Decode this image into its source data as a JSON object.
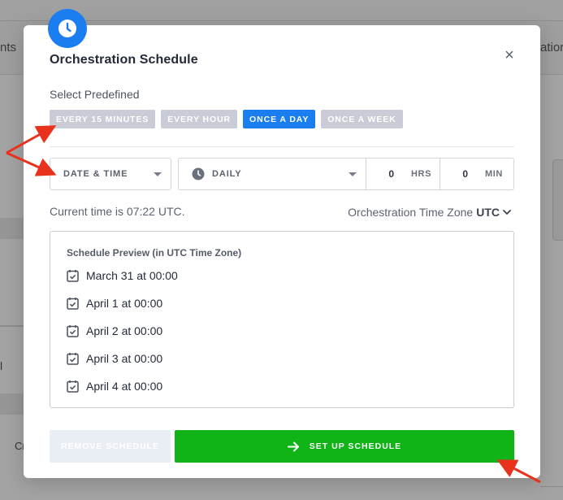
{
  "background": {
    "tab_left_fragment": "nts",
    "tab_right_fragment": "ation",
    "row_fragment_a": "l",
    "row_fragment_b": "Cr"
  },
  "modal": {
    "title": "Orchestration Schedule",
    "header_icon": "clock-icon",
    "close_glyph": "×",
    "select_predefined_label": "Select Predefined",
    "presets": [
      {
        "label": "EVERY 15 MINUTES",
        "active": false
      },
      {
        "label": "EVERY HOUR",
        "active": false
      },
      {
        "label": "ONCE A DAY",
        "active": true
      },
      {
        "label": "ONCE A WEEK",
        "active": false
      }
    ],
    "schedule_type": "DATE & TIME",
    "frequency": "DAILY",
    "hours_value": "0",
    "hours_unit": "HRS",
    "minutes_value": "0",
    "minutes_unit": "MIN",
    "current_time_text": "Current time is 07:22 UTC.",
    "timezone_label": "Orchestration Time Zone",
    "timezone_value": "UTC",
    "preview_title": "Schedule Preview (in UTC Time Zone)",
    "preview_items": [
      "March 31 at 00:00",
      "April 1 at 00:00",
      "April 2 at 00:00",
      "April 3 at 00:00",
      "April 4 at 00:00"
    ],
    "remove_button": "REMOVE SCHEDULE",
    "setup_button": "SET UP SCHEDULE"
  },
  "colors": {
    "accent_blue": "#1a7ef0",
    "preset_inactive": "#c9cbd6",
    "setup_green": "#10b416",
    "remove_disabled": "#e9edf4",
    "annotation_red": "#e8321e"
  }
}
